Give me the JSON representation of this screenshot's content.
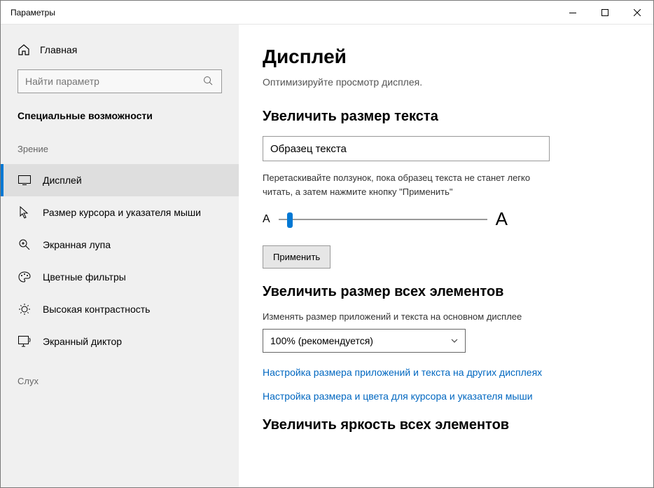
{
  "window": {
    "title": "Параметры"
  },
  "sidebar": {
    "home_label": "Главная",
    "search_placeholder": "Найти параметр",
    "category": "Специальные возможности",
    "group_vision": "Зрение",
    "group_hearing": "Слух",
    "items": [
      {
        "id": "display",
        "label": "Дисплей"
      },
      {
        "id": "cursor",
        "label": "Размер курсора и указателя мыши"
      },
      {
        "id": "magnifier",
        "label": "Экранная лупа"
      },
      {
        "id": "colorfilters",
        "label": "Цветные фильтры"
      },
      {
        "id": "highcontrast",
        "label": "Высокая контрастность"
      },
      {
        "id": "narrator",
        "label": "Экранный диктор"
      }
    ]
  },
  "main": {
    "title": "Дисплей",
    "subtitle": "Оптимизируйте просмотр дисплея.",
    "section_text_size": {
      "heading": "Увеличить размер текста",
      "sample": "Образец текста",
      "instruction": "Перетаскивайте ползунок, пока образец текста не станет легко читать, а затем нажмите кнопку \"Применить\"",
      "small_A": "A",
      "large_A": "A",
      "apply_button": "Применить"
    },
    "section_scale": {
      "heading": "Увеличить размер всех элементов",
      "dropdown_label": "Изменять размер приложений и текста на основном дисплее",
      "dropdown_value": "100% (рекомендуется)",
      "link1": "Настройка размера приложений и текста на других дисплеях",
      "link2": "Настройка размера и цвета для курсора и указателя мыши"
    },
    "section_brightness": {
      "heading": "Увеличить яркость всех элементов"
    }
  }
}
